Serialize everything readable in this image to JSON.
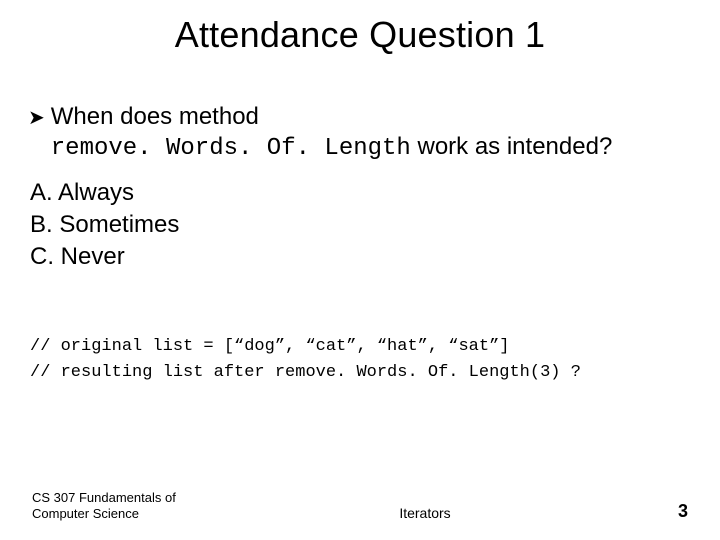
{
  "title": "Attendance Question 1",
  "bullet": {
    "lead": "When does method",
    "code": "remove. Words. Of. Length",
    "tail": " work as intended?"
  },
  "options": {
    "a": "A. Always",
    "b": "B. Sometimes",
    "c": "C. Never"
  },
  "code": {
    "line1": "// original list = [“dog”, “cat”, “hat”, “sat”]",
    "line2_pre": "// resulting list after ",
    "line2_code": "remove. Words. Of. Length(3) ?"
  },
  "footer": {
    "left_l1": "CS 307 Fundamentals of",
    "left_l2": "Computer Science",
    "center": "Iterators",
    "page": "3"
  }
}
